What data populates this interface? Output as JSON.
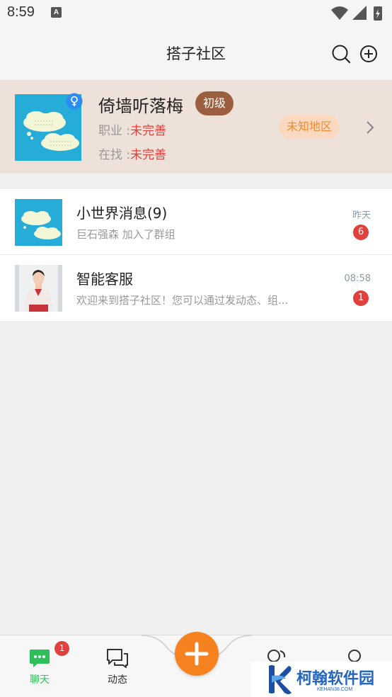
{
  "status_bar": {
    "time": "8:59",
    "notification_icon": "A"
  },
  "header": {
    "title": "搭子社区",
    "icons": [
      "search-icon",
      "add-circle-icon"
    ]
  },
  "profile": {
    "name": "倚墙听落梅",
    "level": "初级",
    "job_label": "职业 :",
    "job_value": "未完善",
    "seeking_label": "在找 :",
    "seeking_value": "未完善",
    "region": "未知地区",
    "gender_icon": "female-icon"
  },
  "chats": [
    {
      "name": "小世界消息(9)",
      "preview": "巨石强森 加入了群组",
      "time": "昨天",
      "unread": "6"
    },
    {
      "name": "智能客服",
      "preview": "欢迎来到搭子社区！您可以通过发动态、组...",
      "time": "08:58",
      "unread": "1"
    }
  ],
  "bottom_nav": {
    "chat_label": "聊天",
    "chat_badge": "1",
    "moments_label": "动态"
  },
  "watermark": {
    "text": "柯翰软件园",
    "sub": "KEHAN38.COM"
  },
  "colors": {
    "accent_green": "#2fbf5a",
    "accent_orange": "#f5821f",
    "badge_red": "#e0413d",
    "level_brown": "#9b5e3f"
  }
}
